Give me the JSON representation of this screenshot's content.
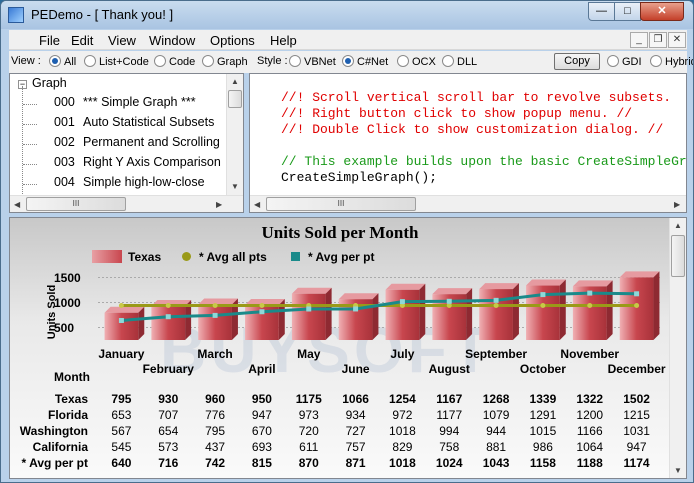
{
  "window": {
    "title": "PEDemo - [ Thank you! ]",
    "min": "—",
    "max": "□",
    "close": "✕"
  },
  "menu": [
    "File",
    "Edit",
    "View",
    "Window",
    "Options",
    "Help"
  ],
  "mdi": {
    "min": "_",
    "restore": "❐",
    "close": "✕"
  },
  "toolbar": {
    "view_label": "View :",
    "view_options": [
      {
        "label": "All",
        "on": true
      },
      {
        "label": "List+Code",
        "on": false
      },
      {
        "label": "Code",
        "on": false
      },
      {
        "label": "Graph",
        "on": false
      }
    ],
    "style_label": "Style :",
    "style_options": [
      {
        "label": "VBNet",
        "on": false
      },
      {
        "label": "C#Net",
        "on": true
      },
      {
        "label": "OCX",
        "on": false
      },
      {
        "label": "DLL",
        "on": false
      }
    ],
    "copy_label": "Copy",
    "render_options": [
      {
        "label": "GDI",
        "on": false
      },
      {
        "label": "Hybrid",
        "on": false
      }
    ]
  },
  "tree": {
    "root": "Graph",
    "items": [
      {
        "num": "000",
        "label": "*** Simple Graph ***"
      },
      {
        "num": "001",
        "label": "Auto Statistical Subsets"
      },
      {
        "num": "002",
        "label": "Permanent and Scrolling"
      },
      {
        "num": "003",
        "label": "Right Y Axis Comparison"
      },
      {
        "num": "004",
        "label": "Simple high-low-close"
      }
    ]
  },
  "code_lines": [
    {
      "text": "//! Scroll vertical scroll bar to revolve subsets.",
      "color": "#e00000"
    },
    {
      "text": "//! Right button click to show popup menu. //",
      "color": "#e00000"
    },
    {
      "text": "//! Double Click to show customization dialog. //",
      "color": "#e00000"
    },
    {
      "text": "",
      "color": "#000000"
    },
    {
      "text": "// This example builds upon the basic CreateSimpleGraph",
      "color": "#1a9a1a"
    },
    {
      "text": "CreateSimpleGraph();",
      "color": "#000000"
    }
  ],
  "scroll_glyphs": {
    "up": "▲",
    "down": "▼",
    "left": "◀",
    "right": "▶",
    "grip": "III"
  },
  "colors": {
    "bar": "#c8464e",
    "avg_all": "#9a9a18",
    "avg_per": "#1a8a8a"
  },
  "chart_data": {
    "type": "bar",
    "title": "Units Sold per Month",
    "ylabel": "Units Sold",
    "xlabel": "Month",
    "ylim": [
      250,
      1650
    ],
    "yticks": [
      500,
      1000,
      1500
    ],
    "categories": [
      "January",
      "February",
      "March",
      "April",
      "May",
      "June",
      "July",
      "August",
      "September",
      "October",
      "November",
      "December"
    ],
    "legend": [
      "Texas",
      "* Avg all pts",
      "* Avg per pt"
    ],
    "series": [
      {
        "name": "Texas",
        "values": [
          795,
          930,
          960,
          950,
          1175,
          1066,
          1254,
          1167,
          1268,
          1339,
          1322,
          1502
        ]
      },
      {
        "name": "Florida",
        "values": [
          653,
          707,
          776,
          947,
          973,
          934,
          972,
          1177,
          1079,
          1291,
          1200,
          1215
        ]
      },
      {
        "name": "Washington",
        "values": [
          567,
          654,
          795,
          670,
          720,
          727,
          1018,
          994,
          944,
          1015,
          1166,
          1031
        ]
      },
      {
        "name": "California",
        "values": [
          545,
          573,
          437,
          693,
          611,
          757,
          829,
          758,
          881,
          986,
          1064,
          947
        ]
      },
      {
        "name": "* Avg per pt",
        "values": [
          640,
          716,
          742,
          815,
          870,
          871,
          1018,
          1024,
          1043,
          1158,
          1188,
          1174
        ]
      }
    ],
    "avg_all_pts": 940,
    "grid": true,
    "legend_position": "top"
  }
}
